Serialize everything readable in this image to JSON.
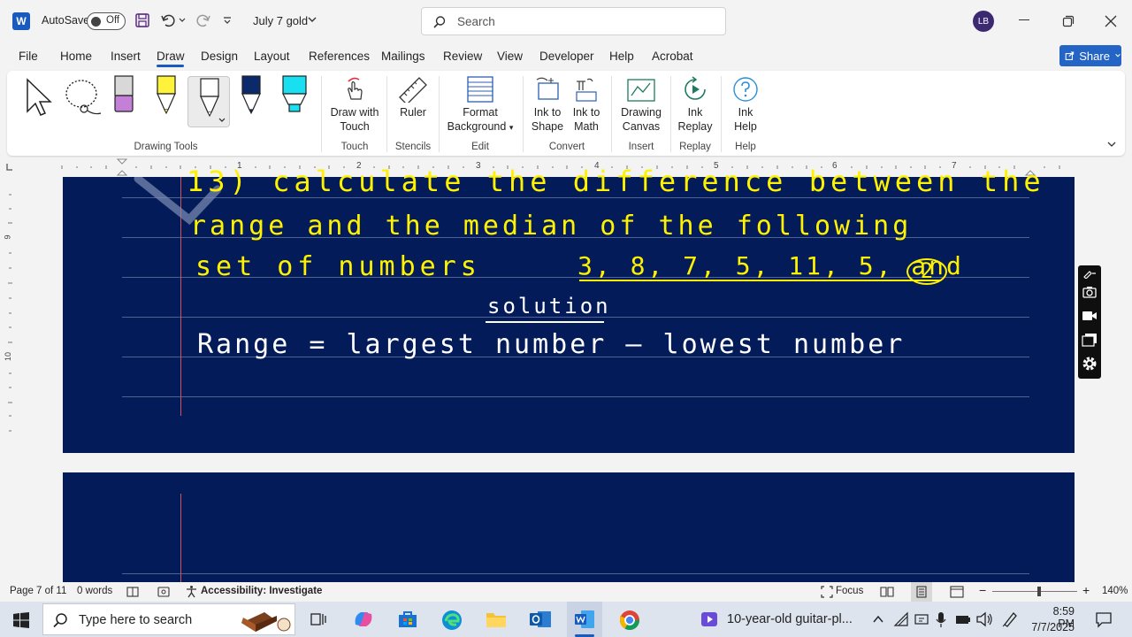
{
  "titlebar": {
    "autosave_label": "AutoSave",
    "autosave_state": "Off",
    "doc_title": "July 7 gold",
    "search_placeholder": "Search",
    "user_initials": "LB"
  },
  "menu": {
    "file": "File",
    "home": "Home",
    "insert": "Insert",
    "draw": "Draw",
    "design": "Design",
    "layout": "Layout",
    "references": "References",
    "mailings": "Mailings",
    "review": "Review",
    "view": "View",
    "developer": "Developer",
    "help": "Help",
    "acrobat": "Acrobat",
    "share": "Share"
  },
  "ribbon": {
    "draw_with_touch_1": "Draw with",
    "draw_with_touch_2": "Touch",
    "ruler": "Ruler",
    "format_bg_1": "Format",
    "format_bg_2": "Background",
    "ink_to_shape_1": "Ink to",
    "ink_to_shape_2": "Shape",
    "ink_to_math_1": "Ink to",
    "ink_to_math_2": "Math",
    "drawing_canvas_1": "Drawing",
    "drawing_canvas_2": "Canvas",
    "ink_replay_1": "Ink",
    "ink_replay_2": "Replay",
    "ink_help_1": "Ink",
    "ink_help_2": "Help",
    "groups": {
      "drawing_tools": "Drawing Tools",
      "touch": "Touch",
      "stencils": "Stencils",
      "edit": "Edit",
      "convert": "Convert",
      "insert": "Insert",
      "replay": "Replay",
      "help": "Help"
    }
  },
  "ruler": {
    "h_numbers": [
      "1",
      "2",
      "3",
      "4",
      "5",
      "6",
      "7"
    ],
    "v_numbers": [
      "9",
      "10"
    ]
  },
  "handwriting": {
    "line1": "13) calculate the difference between the",
    "line2": "range and the median of the following",
    "line3a": "set of numbers",
    "line3b": "3, 8, 7, 5, 11, 5, and",
    "circled": "2",
    "heading": "solution",
    "line5": "Range = largest number — lowest number"
  },
  "statusbar": {
    "page": "Page 7 of 11",
    "words": "0 words",
    "accessibility": "Accessibility: Investigate",
    "focus": "Focus",
    "zoom": "140%"
  },
  "taskbar": {
    "search_placeholder": "Type here to search",
    "media": "10-year-old guitar-pl...",
    "time": "8:59 PM",
    "date": "7/7/2025"
  },
  "colors": {
    "page_bg": "#041b59",
    "ink": "#fff200",
    "ink2": "#ffffff",
    "accent": "#185abd"
  }
}
